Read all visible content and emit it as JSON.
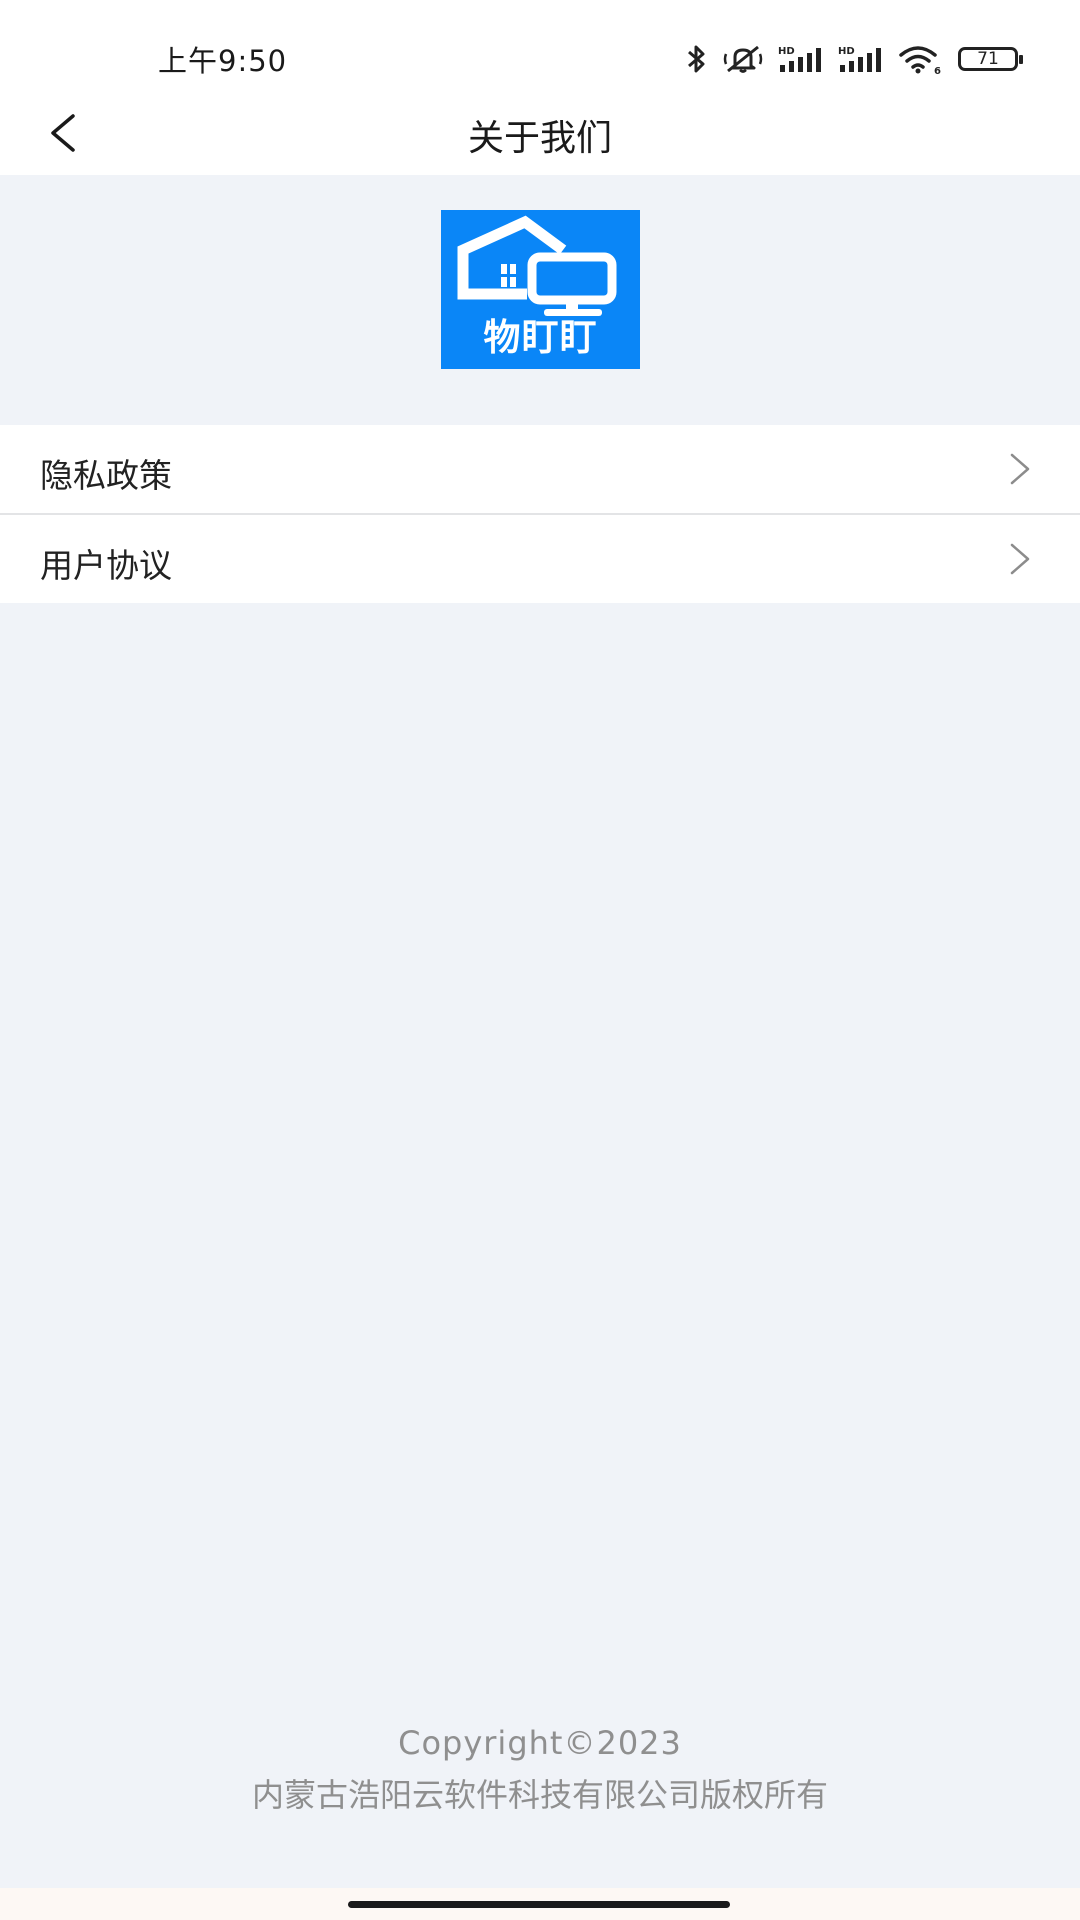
{
  "status_bar": {
    "time": "上午9:50",
    "icons": [
      "bluetooth-icon",
      "mute-icon",
      "hd-signal-icon",
      "hd-signal-icon",
      "wifi-icon"
    ],
    "wifi_label": "6",
    "hd_label": "HD",
    "battery": "71"
  },
  "nav": {
    "title": "关于我们"
  },
  "logo": {
    "text": "物盯盯",
    "color": "#0a86f7"
  },
  "menu": {
    "items": [
      {
        "label": "隐私政策"
      },
      {
        "label": "用户协议"
      }
    ]
  },
  "footer": {
    "copyright": "Copyright©2023",
    "company": "内蒙古浩阳云软件科技有限公司版权所有"
  }
}
